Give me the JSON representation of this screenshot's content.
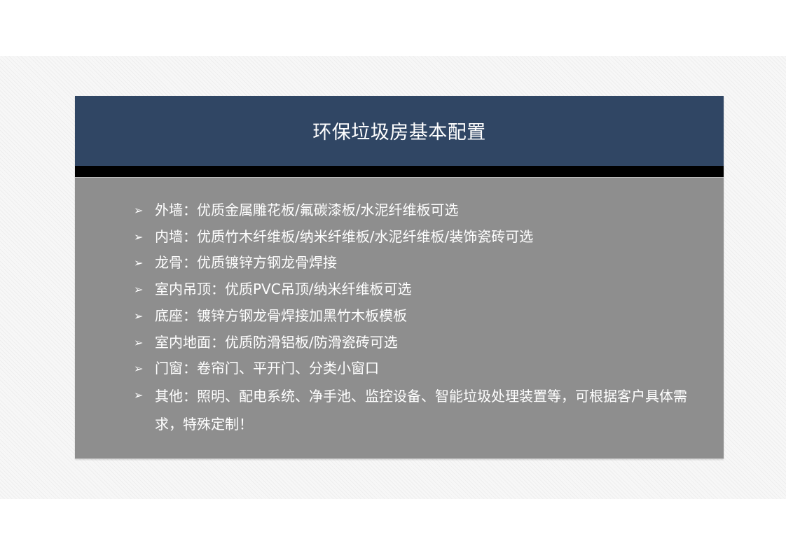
{
  "slide": {
    "title": "环保垃圾房基本配置",
    "bullet_glyph": "➢",
    "items": [
      "外墙：优质金属雕花板/氟碳漆板/水泥纤维板可选",
      "内墙：优质竹木纤维板/纳米纤维板/水泥纤维板/装饰瓷砖可选",
      "龙骨：优质镀锌方钢龙骨焊接",
      "室内吊顶：优质PVC吊顶/纳米纤维板可选",
      "底座：镀锌方钢龙骨焊接加黑竹木板模板",
      "室内地面：优质防滑铝板/防滑瓷砖可选",
      "门窗：卷帘门、平开门、分类小窗口",
      "其他：照明、配电系统、净手池、监控设备、智能垃圾处理装置等，可根据客户具体需求，特殊定制！"
    ]
  },
  "colors": {
    "title_bar": "#304664",
    "band": "#000000",
    "content_bg": "#8e8e8e",
    "text": "#ffffff"
  }
}
